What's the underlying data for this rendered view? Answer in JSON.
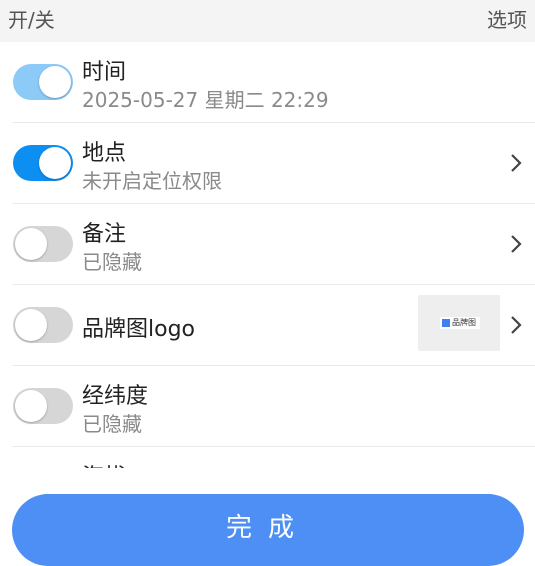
{
  "header": {
    "left_label": "开/关",
    "right_label": "选项"
  },
  "rows": [
    {
      "title": "时间",
      "subtitle": "2025-05-27 星期二 22:29",
      "state": "on-light",
      "chevron": false
    },
    {
      "title": "地点",
      "subtitle": "未开启定位权限",
      "state": "on",
      "chevron": true
    },
    {
      "title": "备注",
      "subtitle": "已隐藏",
      "state": "off",
      "chevron": true
    },
    {
      "title": "品牌图logo",
      "subtitle": "",
      "state": "off",
      "chevron": true,
      "logo_text": "品牌图"
    },
    {
      "title": "经纬度",
      "subtitle": "已隐藏",
      "state": "off",
      "chevron": false
    },
    {
      "title": "海拔",
      "subtitle": "",
      "state": "off",
      "chevron": false
    }
  ],
  "done_button": {
    "label": "完成"
  },
  "colors": {
    "accent": "#0d8ff2",
    "accent_light": "#8ccaf7",
    "button": "#4d8ff4",
    "off": "#d6d6d6"
  },
  "icons": {
    "chevron": "chevron-right-icon"
  }
}
